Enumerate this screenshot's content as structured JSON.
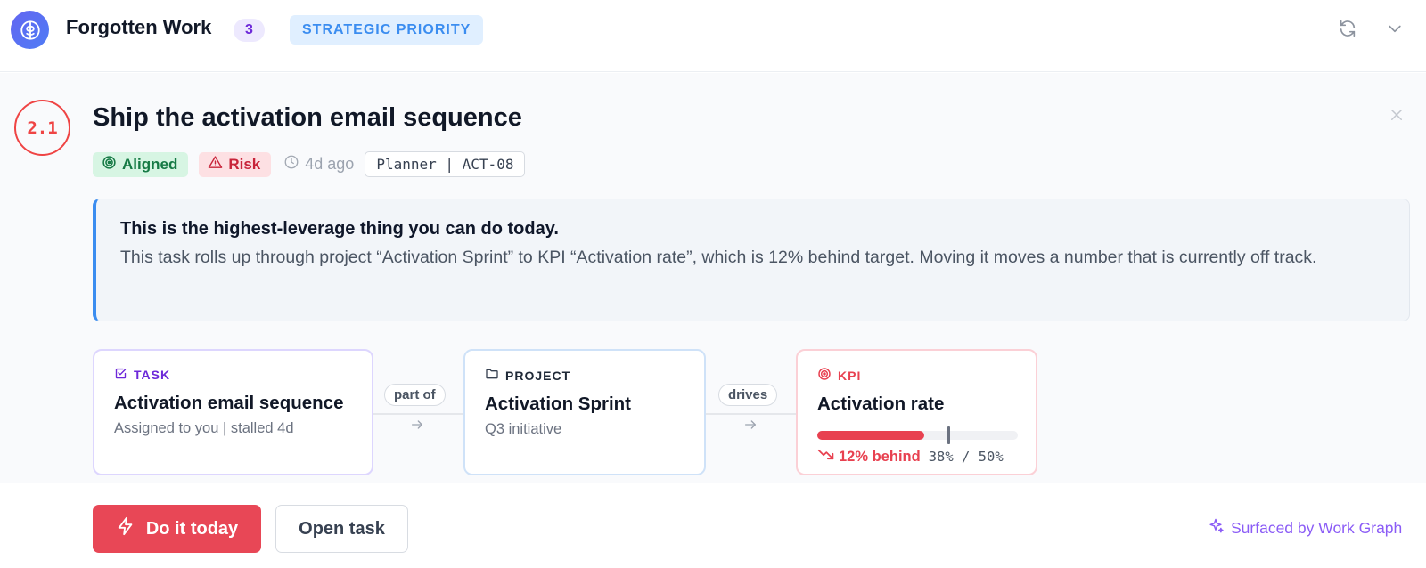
{
  "header": {
    "title": "Forgotten Work",
    "count": "3",
    "priority_tag": "STRATEGIC PRIORITY",
    "icons": {
      "brand": "brain-icon",
      "refresh": "refresh-icon",
      "collapse": "chevron-down-icon"
    }
  },
  "card": {
    "rank": "2.1",
    "title": "Ship the activation email sequence",
    "meta": {
      "aligned_label": "Aligned",
      "risk_label": "Risk",
      "age": "4d ago",
      "source": "Planner | ACT-08"
    },
    "insight": {
      "headline": "This is the highest-leverage thing you can do today.",
      "body": "This task rolls up through project “Activation Sprint” to KPI “Activation rate”, which is 12% behind target. Moving it moves a number that is currently off track."
    },
    "chain": {
      "task": {
        "type_label": "TASK",
        "name": "Activation email sequence",
        "sub": "Assigned to you | stalled 4d"
      },
      "link1": "part of",
      "project": {
        "type_label": "PROJECT",
        "name": "Activation Sprint",
        "sub": "Q3 initiative"
      },
      "link2": "drives",
      "kpi": {
        "type_label": "KPI",
        "name": "Activation rate",
        "behind": "12% behind",
        "values": "38% / 50%",
        "current": 0.38,
        "target": 0.5
      }
    },
    "actions": {
      "primary": "Do it today",
      "secondary": "Open task",
      "surfaced": "Surfaced by Work Graph"
    }
  },
  "colors": {
    "accent_red": "#e84756",
    "accent_blue": "#3b8df0",
    "accent_purple": "#8b5cf6",
    "aligned_green": "#167a45"
  }
}
